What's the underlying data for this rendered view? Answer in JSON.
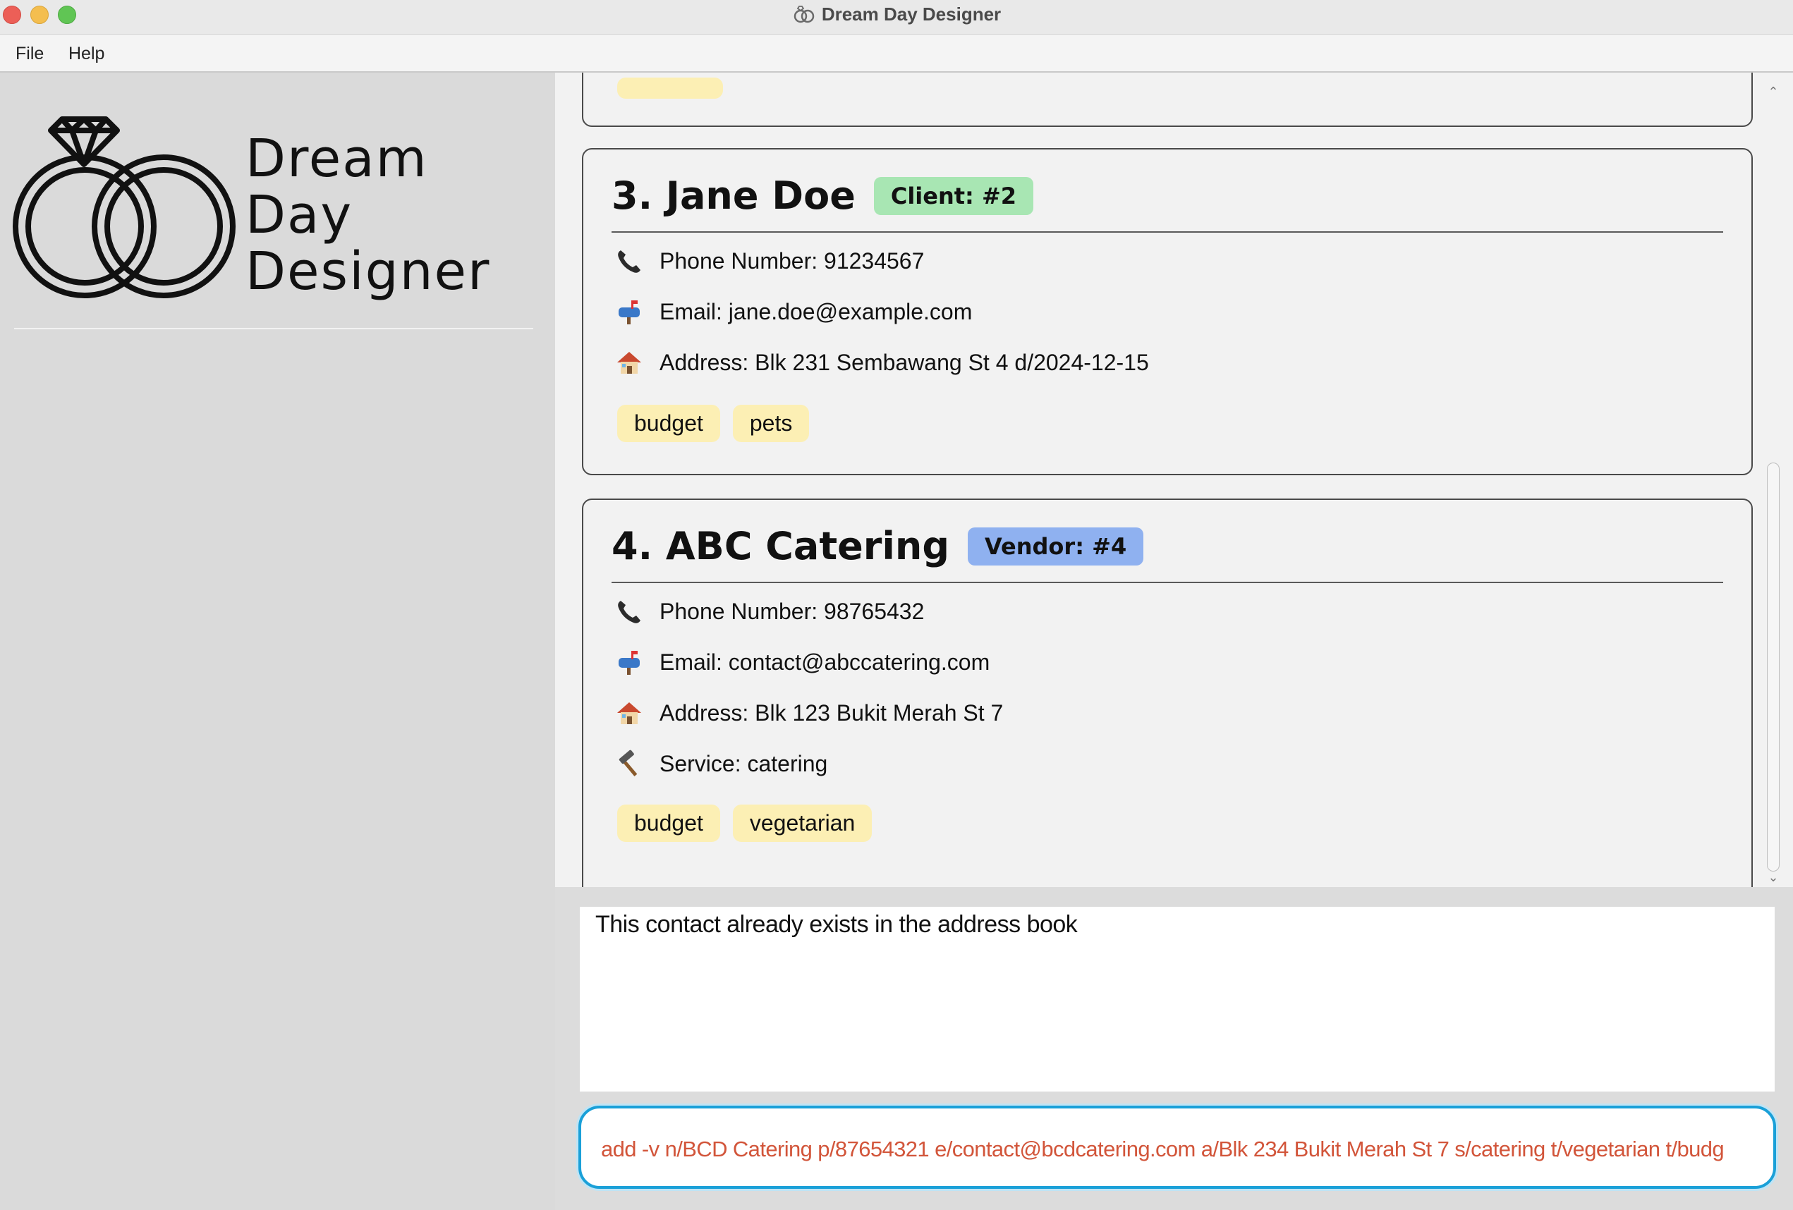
{
  "window": {
    "title": "Dream Day Designer"
  },
  "menu": {
    "file": "File",
    "help": "Help"
  },
  "logo": {
    "line1": "Dream",
    "line2": "Day",
    "line3": "Designer"
  },
  "persons": [
    {
      "index_name": "3. Jane Doe",
      "badge": "Client: #2",
      "badge_color": "#a8e6b3",
      "phone": "Phone Number: 91234567",
      "email": "Email: jane.doe@example.com",
      "address": "Address: Blk 231 Sembawang St 4 d/2024-12-15",
      "tags": [
        "budget",
        "pets"
      ]
    },
    {
      "index_name": "4. ABC Catering",
      "badge": "Vendor: #4",
      "badge_color": "#8fb1f0",
      "phone": "Phone Number: 98765432",
      "email": "Email: contact@abccatering.com",
      "address": "Address: Blk 123 Bukit Merah St 7",
      "service": "Service: catering",
      "tags": [
        "budget",
        "vegetarian"
      ]
    }
  ],
  "icons": {
    "phone": "phone-icon",
    "email": "mailbox-icon",
    "address": "house-icon",
    "service": "hammer-icon"
  },
  "result": {
    "message": "This contact already exists in the address book"
  },
  "command": {
    "value": "add -v n/BCD Catering p/87654321 e/contact@bcdcatering.com a/Blk 234 Bukit Merah St 7 s/catering t/vegetarian t/budg"
  },
  "colors": {
    "tag": "#fcefb4",
    "command_text": "#d2553a",
    "command_border": "#1aa0d8"
  }
}
